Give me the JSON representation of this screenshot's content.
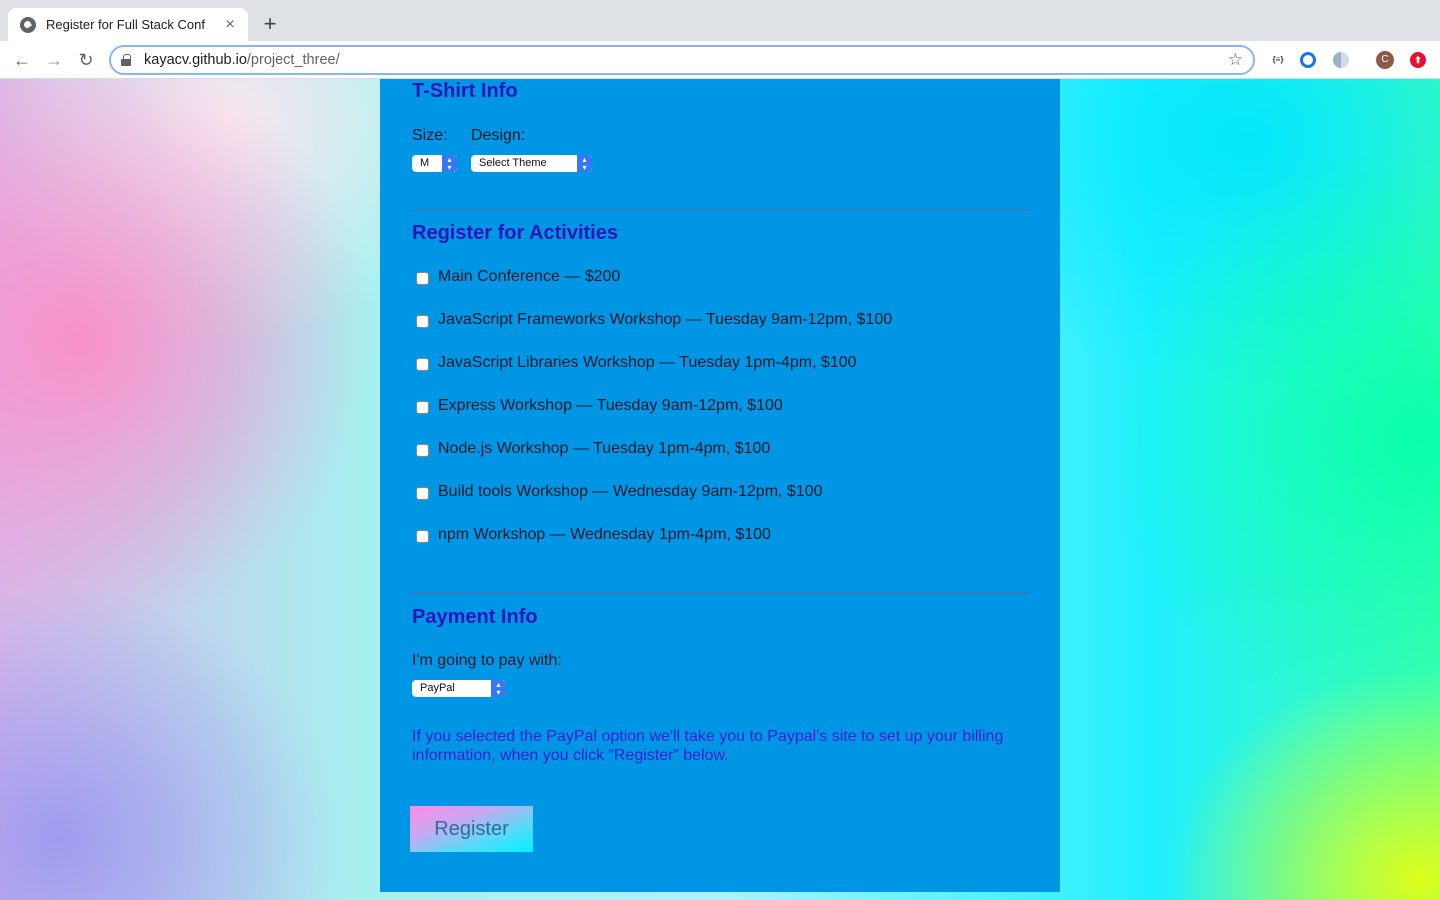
{
  "browser": {
    "tab_title": "Register for Full Stack Conf",
    "tab_close": "×",
    "new_tab": "+",
    "url_host": "kayacv.github.io",
    "url_path": "/project_three/",
    "back": "←",
    "forward": "→",
    "reload": "↻",
    "star": "☆",
    "extensions": [
      {
        "name": "json-viewer-extension-icon",
        "glyph": "{≡}"
      },
      {
        "name": "ring-extension-icon",
        "glyph": ""
      },
      {
        "name": "dark-mode-extension-icon",
        "glyph": ""
      },
      {
        "name": "profile-avatar",
        "glyph": "C"
      },
      {
        "name": "update-extension-icon",
        "glyph": "⬆"
      }
    ]
  },
  "tshirt": {
    "title": "T-Shirt Info",
    "size_label": "Size:",
    "size_value": "M",
    "design_label": "Design:",
    "design_value": "Select Theme"
  },
  "activities": {
    "title": "Register for Activities",
    "items": [
      {
        "label": "Main Conference — $200",
        "checked": false
      },
      {
        "label": "JavaScript Frameworks Workshop — Tuesday 9am-12pm, $100",
        "checked": false
      },
      {
        "label": "JavaScript Libraries Workshop — Tuesday 1pm-4pm, $100",
        "checked": false
      },
      {
        "label": "Express Workshop — Tuesday 9am-12pm, $100",
        "checked": false
      },
      {
        "label": "Node.js Workshop — Tuesday 1pm-4pm, $100",
        "checked": false
      },
      {
        "label": "Build tools Workshop — Wednesday 9am-12pm, $100",
        "checked": false
      },
      {
        "label": "npm Workshop — Wednesday 1pm-4pm, $100",
        "checked": false
      }
    ]
  },
  "payment": {
    "title": "Payment Info",
    "pay_label": "I'm going to pay with:",
    "pay_value": "PayPal",
    "paypal_info": "If you selected the PayPal option we'll take you to Paypal's site to set up your billing information, when you click “Register” below."
  },
  "register_label": "Register",
  "colors": {
    "panel": "#0096e6",
    "heading": "#2b17b8",
    "info_text": "#3a1fcf",
    "select_arrow": "#3478f6"
  }
}
